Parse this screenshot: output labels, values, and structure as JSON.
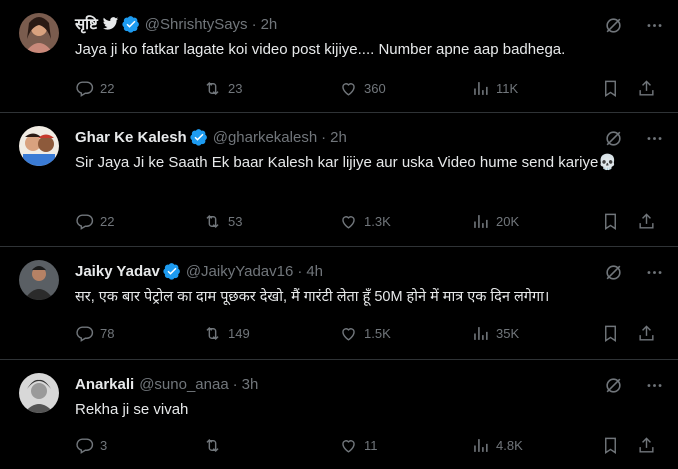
{
  "tweets": [
    {
      "name": "सृष्टि",
      "handle": "@ShrishtySays",
      "time": "2h",
      "text": "Jaya ji ko fatkar lagate koi video post kijiye.... Number apne aap badhega.",
      "replies": "22",
      "retweets": "23",
      "likes": "360",
      "views": "11K"
    },
    {
      "name": "Ghar Ke Kalesh",
      "handle": "@gharkekalesh",
      "time": "2h",
      "text": "Sir Jaya Ji ke Saath Ek baar Kalesh kar lijiye aur uska Video hume send kariye💀",
      "replies": "22",
      "retweets": "53",
      "likes": "1.3K",
      "views": "20K"
    },
    {
      "name": "Jaiky Yadav",
      "handle": "@JaikyYadav16",
      "time": "4h",
      "text": "सर, एक बार पेट्रोल का दाम पूछकर देखो, मैं गारंटी लेता हूँ 50M होने में मात्र एक दिन लगेगा।",
      "replies": "78",
      "retweets": "149",
      "likes": "1.5K",
      "views": "35K"
    },
    {
      "name": "Anarkali",
      "handle": "@suno_anaa",
      "time": "3h",
      "text": "Rekha ji se vivah",
      "replies": "3",
      "retweets": "",
      "likes": "11",
      "views": "4.8K"
    }
  ],
  "colors": {
    "background": "#000000",
    "text": "#e7e9ea",
    "muted": "#71767b",
    "verified": "#1d9bf0",
    "gold": "#e2b719",
    "divider": "#2f3336"
  },
  "icons": [
    "verified-badge-icon",
    "bird-icon",
    "grok-icon",
    "more-icon",
    "reply-icon",
    "retweet-icon",
    "like-icon",
    "views-icon",
    "bookmark-icon",
    "share-icon"
  ]
}
